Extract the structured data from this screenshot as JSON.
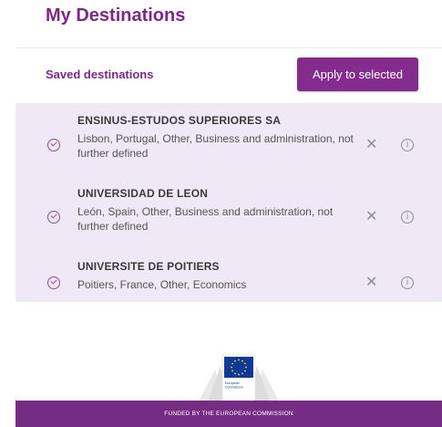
{
  "page": {
    "title": "My Destinations"
  },
  "saved": {
    "label": "Saved destinations",
    "apply_button": "Apply to selected"
  },
  "destinations": [
    {
      "name": "ENSINUS-ESTUDOS SUPERIORES SA",
      "details": "Lisbon, Portugal, Other, Business and administration, not further defined",
      "selected": true
    },
    {
      "name": "UNIVERSIDAD DE LEON",
      "details": "León, Spain, Other, Business and administration, not further defined",
      "selected": true
    },
    {
      "name": "UNIVERSITE DE POITIERS",
      "details": "Poitiers, France, Other, Economics",
      "selected": true
    }
  ],
  "icons": {
    "selected": "check-circle-icon",
    "remove": "close-icon",
    "info": "info-icon"
  },
  "logo": {
    "line1": "European",
    "line2": "Commission"
  },
  "footer": {
    "text": "FUNDED BY THE EUROPEAN COMMISSION"
  },
  "colors": {
    "accent": "#842b8e",
    "title": "#7a2a86",
    "list_bg": "#f1e8f6",
    "footer_bg": "#752c83"
  }
}
